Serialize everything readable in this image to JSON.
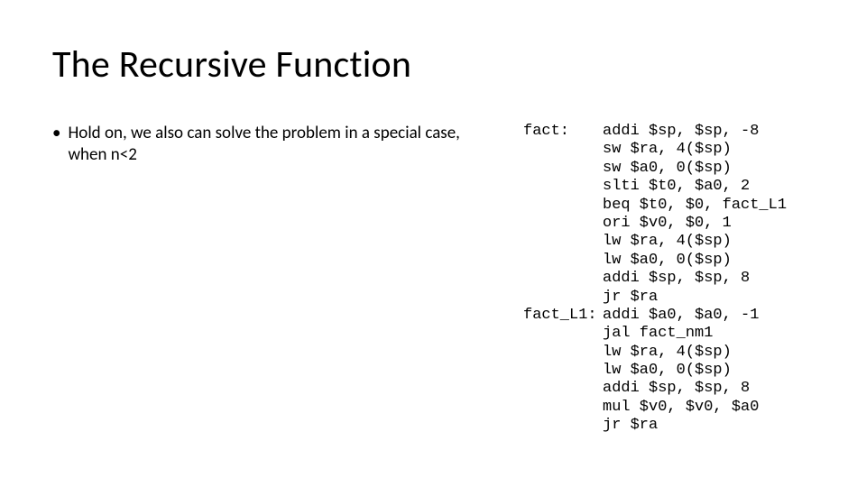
{
  "title": "The Recursive Function",
  "bullet": {
    "marker": "•",
    "text": "Hold on, we also can solve the problem in a special case, when n<2"
  },
  "code": {
    "lines": [
      {
        "label": "fact:",
        "instr": "addi $sp, $sp, -8"
      },
      {
        "label": "",
        "instr": "sw $ra, 4($sp)"
      },
      {
        "label": "",
        "instr": "sw $a0, 0($sp)"
      },
      {
        "label": "",
        "instr": "slti $t0, $a0, 2"
      },
      {
        "label": "",
        "instr": "beq $t0, $0, fact_L1"
      },
      {
        "label": "",
        "instr": "ori $v0, $0, 1"
      },
      {
        "label": "",
        "instr": "lw $ra, 4($sp)"
      },
      {
        "label": "",
        "instr": "lw $a0, 0($sp)"
      },
      {
        "label": "",
        "instr": "addi $sp, $sp, 8"
      },
      {
        "label": "",
        "instr": "jr $ra"
      },
      {
        "label": "fact_L1:",
        "instr": "addi $a0, $a0, -1"
      },
      {
        "label": "",
        "instr": "jal fact_nm1"
      },
      {
        "label": "",
        "instr": "lw $ra, 4($sp)"
      },
      {
        "label": "",
        "instr": "lw $a0, 0($sp)"
      },
      {
        "label": "",
        "instr": "addi $sp, $sp, 8"
      },
      {
        "label": "",
        "instr": "mul $v0, $v0, $a0"
      },
      {
        "label": "",
        "instr": "jr $ra"
      }
    ]
  }
}
